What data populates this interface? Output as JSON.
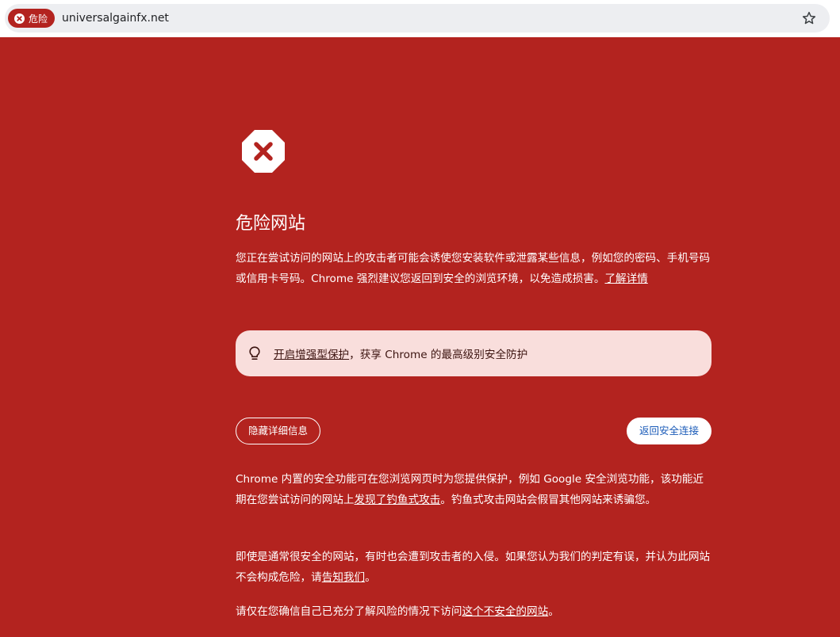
{
  "omnibox": {
    "security_chip_label": "危险",
    "url": "universalgainfx.net",
    "bookmark_icon": "star-outline-icon",
    "security_icon": "danger-circle-x-icon"
  },
  "colors": {
    "page_background": "#b3231f",
    "enhanced_box_background": "#f9dedc",
    "primary_button_text": "#1a5bb8"
  },
  "interstitial": {
    "icon": "danger-octagon-x-icon",
    "heading": "危险网站",
    "intro": {
      "text": "您正在尝试访问的网站上的攻击者可能会诱使您安装软件或泄露某些信息，例如您的密码、手机号码或信用卡号码。Chrome 强烈建议您返回到安全的浏览环境，以免造成损害。",
      "link": "了解详情"
    },
    "enhanced_protection": {
      "icon": "lightbulb-icon",
      "link": "开启增强型保护",
      "text": "，获享 Chrome 的最高级别安全防护"
    },
    "buttons": {
      "hide_details": "隐藏详细信息",
      "back_to_safety": "返回安全连接"
    },
    "details": {
      "p1_before": "Chrome 内置的安全功能可在您浏览网页时为您提供保护，例如 Google 安全浏览功能，该功能近期在您尝试访问的网站上",
      "p1_link": "发现了钓鱼式攻击",
      "p1_after": "。钓鱼式攻击网站会假冒其他网站来诱骗您。",
      "p2_before": "即使是通常很安全的网站，有时也会遭到攻击者的入侵。如果您认为我们的判定有误，并认为此网站不会构成危险，请",
      "p2_link": "告知我们",
      "p2_after": "。",
      "p3_before": "请仅在您确信自己已充分了解风险的情况下访问",
      "p3_link": "这个不安全的网站",
      "p3_after": "。"
    }
  }
}
